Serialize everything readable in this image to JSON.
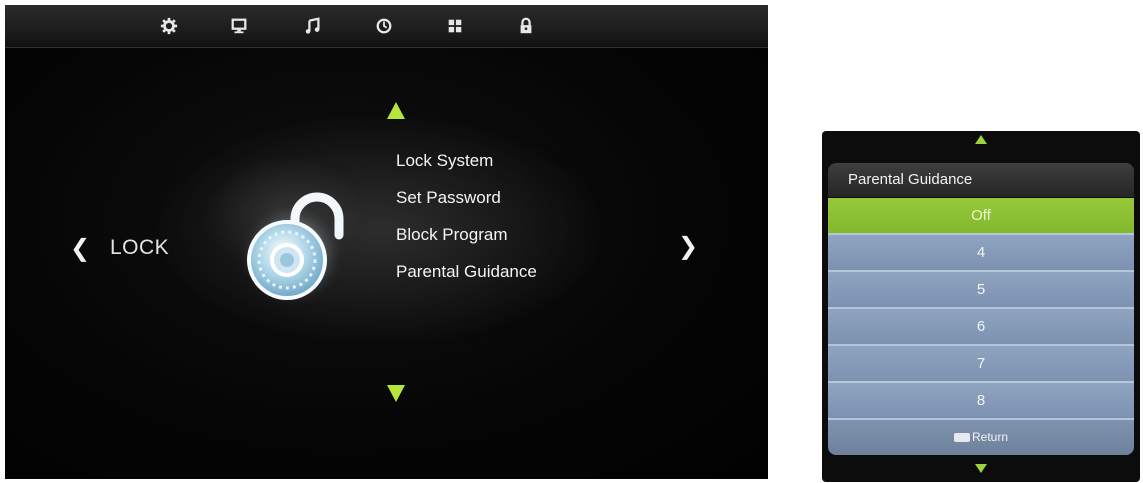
{
  "top_menu": {
    "icons": [
      "settings-gear-icon",
      "monitor-icon",
      "music-note-icon",
      "clock-icon",
      "grid-apps-icon",
      "lock-icon"
    ]
  },
  "lock_page": {
    "section_label": "LOCK",
    "menu_items": [
      "Lock System",
      "Set Password",
      "Block Program",
      "Parental Guidance"
    ]
  },
  "parental_guidance_popup": {
    "title": "Parental Guidance",
    "options": [
      "Off",
      "4",
      "5",
      "6",
      "7",
      "8"
    ],
    "selected": "Off",
    "return_label": "Return"
  },
  "colors": {
    "accent_green": "#b6e63a",
    "selected_row": "#8fc236",
    "row_blue": "#8398b6"
  }
}
